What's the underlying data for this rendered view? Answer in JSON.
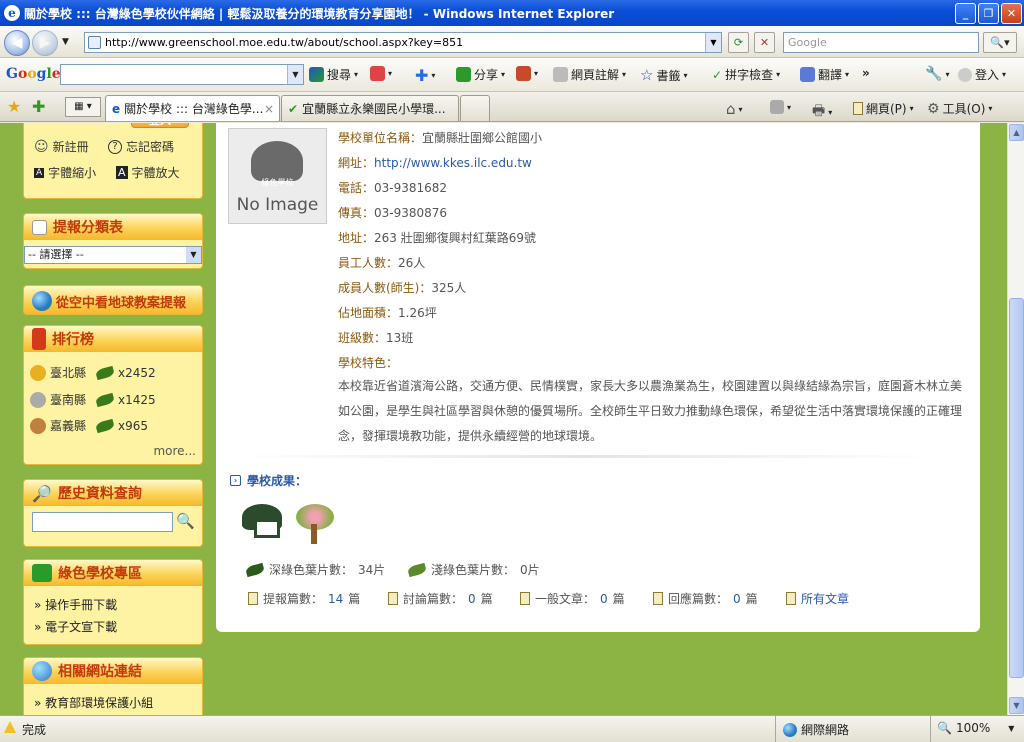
{
  "window": {
    "title": "關於學校 ::: 台灣綠色學校伙伴網絡 | 輕鬆汲取養分的環境教育分享園地！ - Windows Internet Explorer"
  },
  "address": {
    "url": "http://www.greenschool.moe.edu.tw/about/school.aspx?key=851",
    "search_placeholder": "Google"
  },
  "google_toolbar": {
    "logo": "Google",
    "search": "搜尋",
    "share": "分享",
    "annotate": "網頁註解",
    "bookmarks": "書籤",
    "spellcheck": "拼字檢查",
    "translate": "翻譯",
    "more": "»",
    "signin": "登入"
  },
  "tabs": [
    {
      "label": "關於學校 ::: 台灣綠色學...",
      "close": "×"
    },
    {
      "label": "宜蘭縣立永樂國民小學環..."
    }
  ],
  "command_bar": {
    "page": "網頁(P)",
    "tools": "工具(O)"
  },
  "sidebar": {
    "login_button": "登入",
    "register": "新註冊",
    "forgot": "忘記密碼",
    "font_small": "字體縮小",
    "font_large": "字體放大",
    "font_glyph": "A",
    "report_title": "提報分類表",
    "report_select": "-- 請選擇 --",
    "earth_link": "從空中看地球教案提報",
    "ranking_title": "排行榜",
    "ranking": [
      {
        "name": "臺北縣",
        "count": "x2452"
      },
      {
        "name": "臺南縣",
        "count": "x1425"
      },
      {
        "name": "嘉義縣",
        "count": "x965"
      }
    ],
    "more": "more...",
    "history_title": "歷史資料查詢",
    "green_title": "綠色學校專區",
    "green_links": [
      "» 操作手冊下載",
      "» 電子文宣下載"
    ],
    "related_title": "相關網站連結",
    "related_links": [
      "» 教育部環境保護小組"
    ]
  },
  "school": {
    "noimage": "No Image",
    "noimage_sub": "綠色學校",
    "name_label": "學校單位名稱：",
    "name": "宜蘭縣壯圍鄉公館國小",
    "url_label": "網址：",
    "url": "http://www.kkes.ilc.edu.tw",
    "phone_label": "電話：",
    "phone": "03-9381682",
    "fax_label": "傳真：",
    "fax": "03-9380876",
    "address_label": "地址：",
    "address": "263 壯圍鄉復興村紅葉路69號",
    "staff_label": "員工人數：",
    "staff": "26人",
    "members_label": "成員人數(師生)：",
    "members": "325人",
    "area_label": "佔地面積：",
    "area": "1.26坪",
    "classes_label": "班級數：",
    "classes": "13班",
    "features_label": "學校特色：",
    "features": "本校靠近省道濱海公路，交通方便、民情樸實，家長大多以農漁業為生，校園建置以與綠結緣為宗旨，庭園蒼木林立美如公園，是學生與社區學習與休憩的優質場所。全校師生平日致力推動綠色環保，希望從生活中落實環境保護的正確理念，發揮環境教功能，提供永續經營的地球環境。"
  },
  "achievements": {
    "title": "學校成果：",
    "dark_leaves_label": "深綠色葉片數：",
    "dark_leaves": "34片",
    "light_leaves_label": "淺綠色葉片數：",
    "light_leaves": "0片",
    "reports_label": "提報篇數：",
    "reports": "14",
    "discuss_label": "討論篇數：",
    "discuss": "0",
    "general_label": "一般文章：",
    "general": "0",
    "reply_label": "回應篇數：",
    "reply": "0",
    "unit": "篇",
    "all_articles": "所有文章"
  },
  "status": {
    "text": "完成",
    "zone": "網際網路",
    "zoom": "100%"
  }
}
